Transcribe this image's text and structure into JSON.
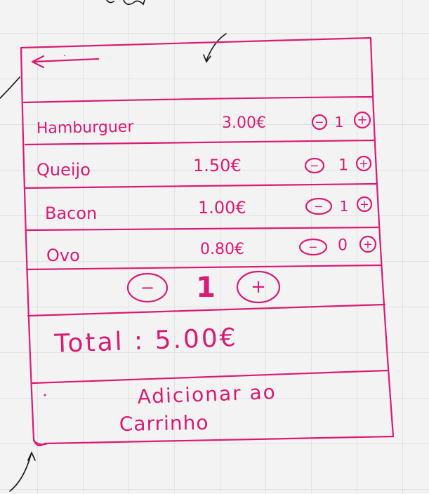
{
  "items": [
    {
      "name": "Hamburguer",
      "price": "3.00€",
      "qty": "1",
      "minus": "−",
      "plus": "+"
    },
    {
      "name": "Queijo",
      "price": "1.50€",
      "qty": "1",
      "minus": "−",
      "plus": "+"
    },
    {
      "name": "Bacon",
      "price": "1.00€",
      "qty": "1",
      "minus": "−",
      "plus": "+"
    },
    {
      "name": "Ovo",
      "price": "0.80€",
      "qty": "0",
      "minus": "−",
      "plus": "+"
    }
  ],
  "quantity": {
    "minus": "−",
    "value": "1",
    "plus": "+"
  },
  "total": "Total : 5.00€",
  "cart_button": {
    "line1": "Adicionar ao",
    "line2": "Carrinho"
  },
  "ink_color": "#d81b73"
}
